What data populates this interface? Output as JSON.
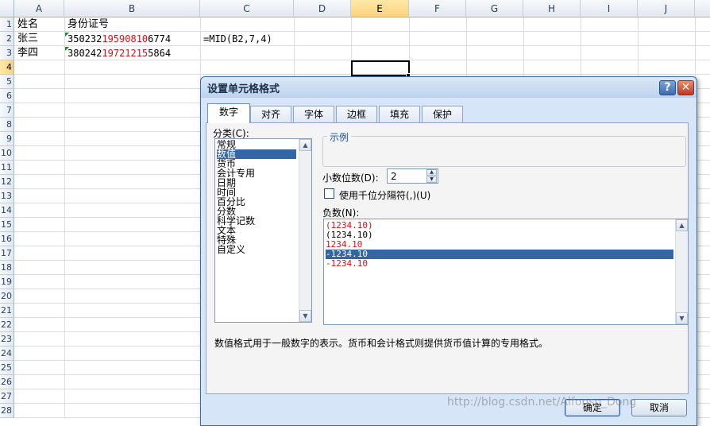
{
  "sheet": {
    "columns": [
      "A",
      "B",
      "C",
      "D",
      "E",
      "F",
      "G",
      "H",
      "I",
      "J"
    ],
    "rows": [
      "1",
      "2",
      "3",
      "4",
      "5",
      "6",
      "7",
      "8",
      "9",
      "10",
      "11",
      "12",
      "13",
      "14",
      "15",
      "16",
      "17",
      "18",
      "19",
      "20",
      "21",
      "22",
      "23",
      "24",
      "25",
      "26",
      "27",
      "28"
    ],
    "selected_column": "E",
    "selected_row": "4",
    "cells": {
      "a1": "姓名",
      "b1": "身份证号",
      "a2": "张三",
      "b2_pre": "350232",
      "b2_mid": "19590810",
      "b2_post": "6774",
      "c2": "=MID(B2,7,4)",
      "a3": "李四",
      "b3_pre": "380242",
      "b3_mid": "19721215",
      "b3_post": "5864"
    }
  },
  "dialog": {
    "title": "设置单元格格式",
    "help_label": "?",
    "close_label": "✕",
    "tabs": [
      "数字",
      "对齐",
      "字体",
      "边框",
      "填充",
      "保护"
    ],
    "active_tab": "数字",
    "category_label": "分类(C):",
    "categories": [
      "常规",
      "数值",
      "货币",
      "会计专用",
      "日期",
      "时间",
      "百分比",
      "分数",
      "科学记数",
      "文本",
      "特殊",
      "自定义"
    ],
    "selected_category": "数值",
    "sample_label": "示例",
    "decimal_label": "小数位数(D):",
    "decimal_value": "2",
    "thousands_label": "使用千位分隔符(,)(U)",
    "negative_label": "负数(N):",
    "negative_options": [
      {
        "text": "(1234.10)",
        "color": "#d4141a"
      },
      {
        "text": "(1234.10)",
        "color": "#000000"
      },
      {
        "text": "1234.10",
        "color": "#d4141a"
      },
      {
        "text": "-1234.10",
        "color": "#ffffff"
      },
      {
        "text": "-1234.10",
        "color": "#d4141a"
      }
    ],
    "selected_negative": 3,
    "description": "数值格式用于一般数字的表示。货币和会计格式则提供货币值计算的专用格式。",
    "ok_label": "确定",
    "cancel_label": "取消"
  },
  "watermark": "http://blog.csdn.net/Alfonso_Dong",
  "colors": {
    "accent": "#3465a4",
    "red_text": "#d4141a",
    "dialog_bg": "#d6e5f7"
  }
}
